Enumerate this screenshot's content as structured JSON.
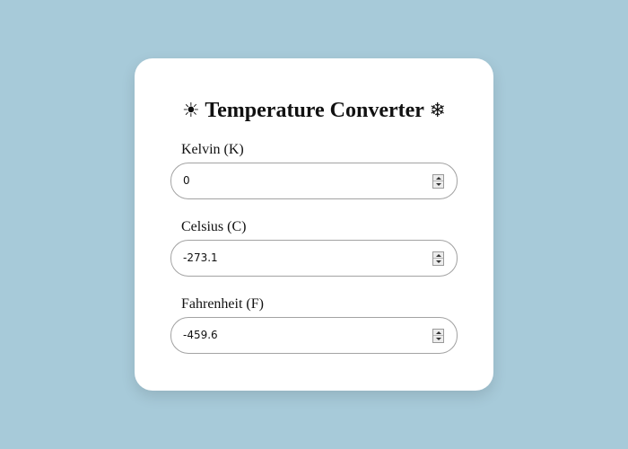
{
  "converter": {
    "title": "Temperature Converter",
    "title_left_icon": "sun-icon",
    "title_left_glyph": "☀",
    "title_right_icon": "snowflake-icon",
    "title_right_glyph": "❄",
    "fields": [
      {
        "label": "Kelvin (K)",
        "value": "0"
      },
      {
        "label": "Celsius (C)",
        "value": "-273.1"
      },
      {
        "label": "Fahrenheit (F)",
        "value": "-459.6"
      }
    ]
  },
  "colors": {
    "background": "#a7cad9",
    "card": "#ffffff",
    "field_border": "#a3a3a3"
  }
}
